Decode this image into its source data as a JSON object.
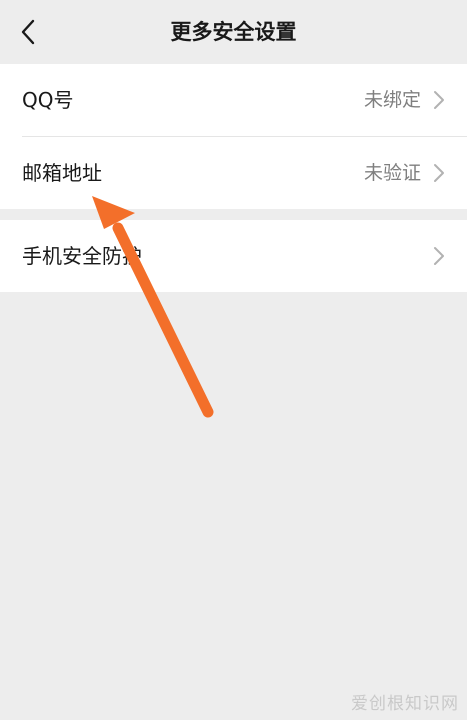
{
  "nav": {
    "title": "更多安全设置",
    "back_icon": "chevron-left-icon"
  },
  "settings": {
    "rows": [
      {
        "label": "QQ号",
        "value": "未绑定",
        "icon": "chevron-right-icon"
      },
      {
        "label": "邮箱地址",
        "value": "未验证",
        "icon": "chevron-right-icon"
      },
      {
        "label": "手机安全防护",
        "value": "",
        "icon": "chevron-right-icon"
      }
    ]
  },
  "annotation": {
    "arrow_color": "#f36f2a"
  },
  "watermark": "爱创根知识网",
  "colors": {
    "background": "#ededed",
    "card": "#ffffff",
    "text": "#191919",
    "secondary_text": "#7f7f7f"
  }
}
